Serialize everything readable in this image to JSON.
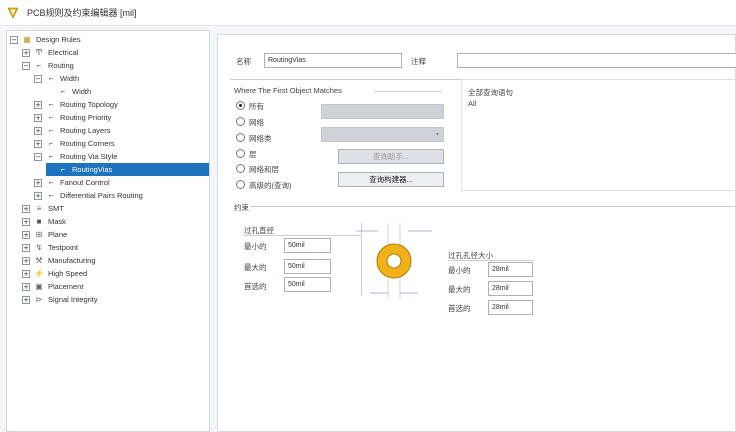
{
  "window": {
    "title": "PCB规则及约束编辑器 [mil]"
  },
  "tree": {
    "nodes": [
      {
        "label": "Design Rules",
        "expander": "−",
        "icon": "folder-icon",
        "glyph": "▦"
      },
      {
        "label": "Electrical",
        "expander": "+",
        "icon": "electrical-icon",
        "glyph": "Ͳ"
      },
      {
        "label": "Routing",
        "expander": "−",
        "icon": "routing-icon",
        "glyph": "⌐"
      },
      {
        "label": "Width",
        "expander": "−",
        "icon": "width-icon",
        "glyph": "⌐"
      },
      {
        "label": "Width",
        "expander": "",
        "icon": "rule-icon",
        "glyph": "⌐"
      },
      {
        "label": "Routing Topology",
        "expander": "+",
        "icon": "topology-icon",
        "glyph": "⌐"
      },
      {
        "label": "Routing Priority",
        "expander": "+",
        "icon": "priority-icon",
        "glyph": "⌐"
      },
      {
        "label": "Routing Layers",
        "expander": "+",
        "icon": "layers-icon",
        "glyph": "⌐"
      },
      {
        "label": "Routing Corners",
        "expander": "+",
        "icon": "corners-icon",
        "glyph": "⌐"
      },
      {
        "label": "Routing Via Style",
        "expander": "−",
        "icon": "via-style-icon",
        "glyph": "⌐"
      },
      {
        "label": "RoutingVias",
        "expander": "",
        "icon": "rule-icon",
        "glyph": "⌐"
      },
      {
        "label": "Fanout Control",
        "expander": "+",
        "icon": "fanout-icon",
        "glyph": "⌐"
      },
      {
        "label": "Differential Pairs Routing",
        "expander": "+",
        "icon": "diff-pairs-icon",
        "glyph": "⌐"
      },
      {
        "label": "SMT",
        "expander": "+",
        "icon": "smt-icon",
        "glyph": "≡"
      },
      {
        "label": "Mask",
        "expander": "+",
        "icon": "mask-icon",
        "glyph": "■"
      },
      {
        "label": "Plane",
        "expander": "+",
        "icon": "plane-icon",
        "glyph": "⊞"
      },
      {
        "label": "Testpoint",
        "expander": "+",
        "icon": "testpoint-icon",
        "glyph": "↯"
      },
      {
        "label": "Manufacturing",
        "expander": "+",
        "icon": "manufacturing-icon",
        "glyph": "⚒"
      },
      {
        "label": "High Speed",
        "expander": "+",
        "icon": "high-speed-icon",
        "glyph": "⚡"
      },
      {
        "label": "Placement",
        "expander": "+",
        "icon": "placement-icon",
        "glyph": "▣"
      },
      {
        "label": "Signal Integrity",
        "expander": "+",
        "icon": "signal-integrity-icon",
        "glyph": "⊳"
      }
    ]
  },
  "rule": {
    "name_label": "名称",
    "name_value": "RoutingVias",
    "comment_label": "注释",
    "comment_value": ""
  },
  "match": {
    "heading": "Where The First Object Matches",
    "options": [
      "所有",
      "网络",
      "网络类",
      "层",
      "网络和层",
      "高级的(查询)"
    ],
    "selected_index": 0,
    "query_helper_button": "查询助手...",
    "query_builder_button": "查询构建器...",
    "full_query_heading": "全部查询语句",
    "full_query_value": "All"
  },
  "constraints": {
    "heading": "约束",
    "via_diameter": {
      "title": "过孔直径",
      "min_label": "最小的",
      "min_value": "50mil",
      "max_label": "最大的",
      "max_value": "50mil",
      "pref_label": "首选的",
      "pref_value": "50mil"
    },
    "hole_size": {
      "title": "过孔孔径大小",
      "min_label": "最小的",
      "min_value": "28mil",
      "max_label": "最大的",
      "max_value": "28mil",
      "pref_label": "首选的",
      "pref_value": "28mil"
    }
  },
  "colors": {
    "selection": "#1e73be",
    "via_ring": "#f0b11a",
    "via_ring_outline": "#b07b00"
  }
}
